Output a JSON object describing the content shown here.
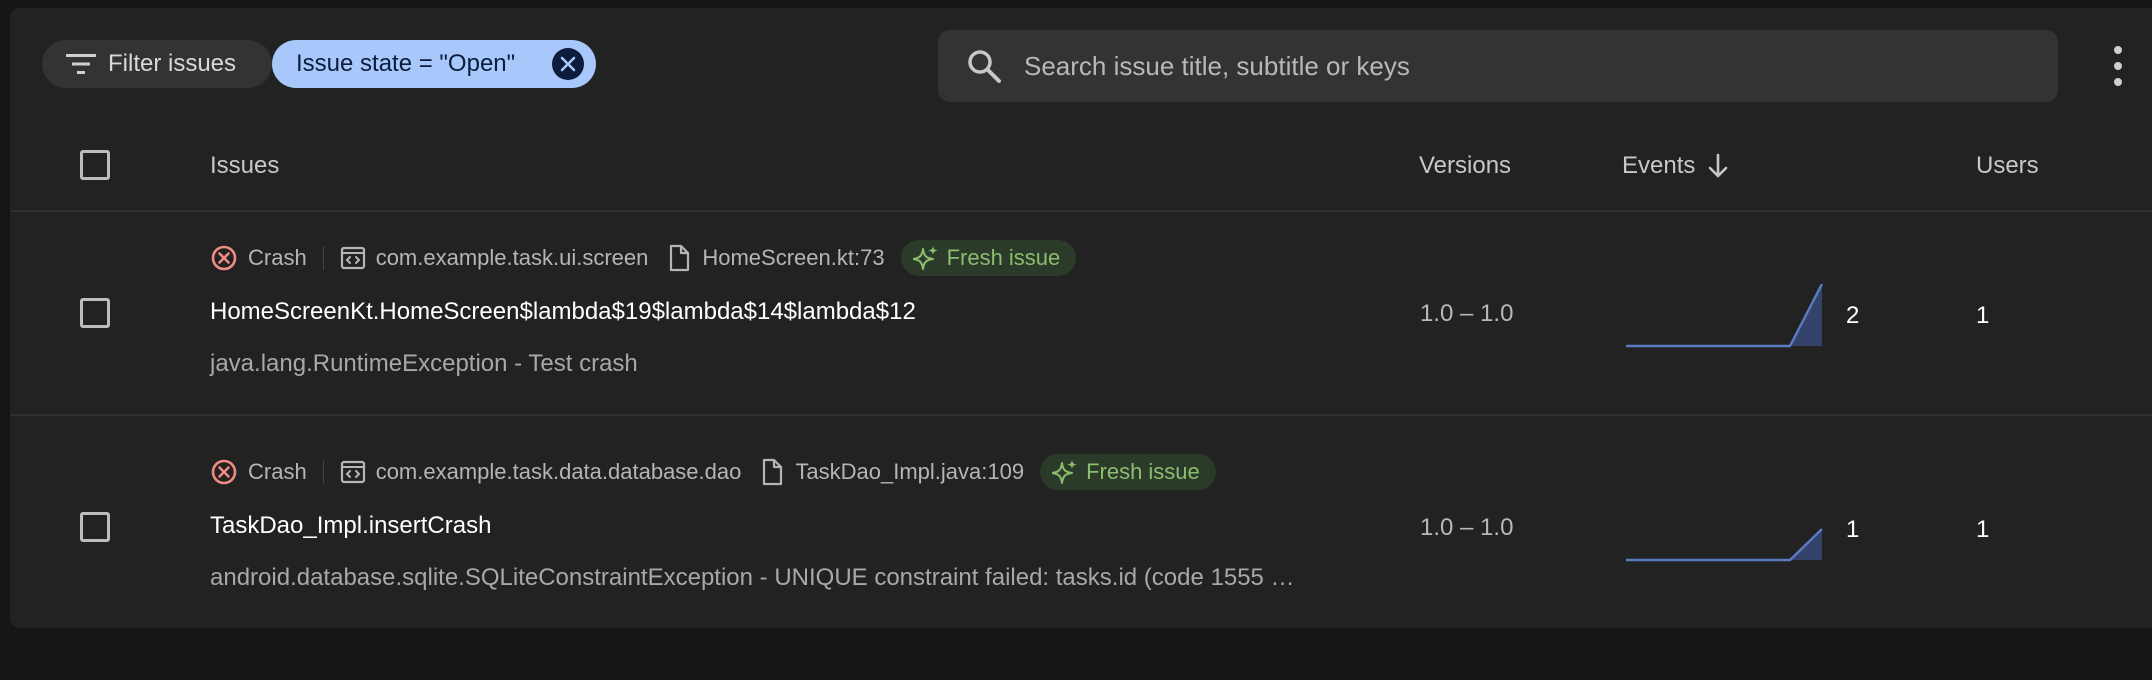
{
  "toolbar": {
    "filter_label": "Filter issues",
    "state_chip_label": "Issue state = \"Open\"",
    "search_placeholder": "Search issue title, subtitle or keys"
  },
  "table": {
    "headers": {
      "issues": "Issues",
      "versions": "Versions",
      "events": "Events",
      "users": "Users"
    },
    "rows": [
      {
        "type": "Crash",
        "package": "com.example.task.ui.screen",
        "file": "HomeScreen.kt:73",
        "badge": "Fresh issue",
        "title": "HomeScreenKt.HomeScreen$lambda$19$lambda$14$lambda$12",
        "subtitle": "java.lang.RuntimeException - Test crash",
        "versions": "1.0 – 1.0",
        "events": "2",
        "users": "1",
        "sparkline": [
          0,
          0,
          0,
          0,
          0,
          0,
          2
        ]
      },
      {
        "type": "Crash",
        "package": "com.example.task.data.database.dao",
        "file": "TaskDao_Impl.java:109",
        "badge": "Fresh issue",
        "title": "TaskDao_Impl.insertCrash",
        "subtitle": "android.database.sqlite.SQLiteConstraintException - UNIQUE constraint failed: tasks.id (code 1555 …",
        "versions": "1.0 – 1.0",
        "events": "1",
        "users": "1",
        "sparkline": [
          0,
          0,
          0,
          0,
          0,
          0,
          1
        ]
      }
    ]
  },
  "icons": {
    "filter": "filter-icon",
    "close": "close-icon",
    "search": "search-icon",
    "more": "more-vert-icon",
    "sort": "arrow-down-icon",
    "crash": "crash-icon",
    "package": "package-icon",
    "file": "file-icon",
    "sparkle": "sparkle-icon"
  },
  "colors": {
    "accent_chip": "#a8c7fa",
    "fresh_text": "#8bbd6f",
    "crash_icon": "#f28b82",
    "sparkline": "#5b7cc4"
  }
}
